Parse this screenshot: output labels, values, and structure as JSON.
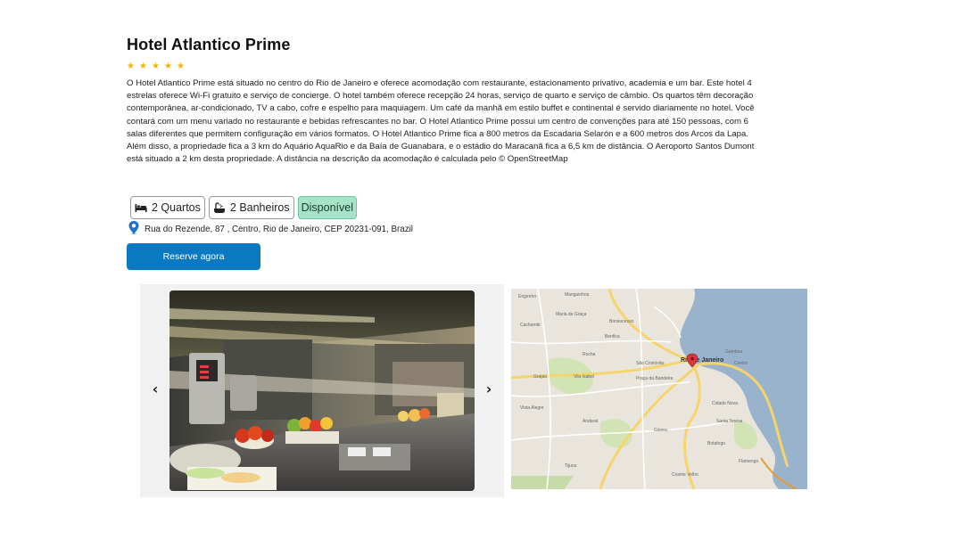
{
  "hotel": {
    "name": "Hotel Atlantico Prime",
    "stars": 5,
    "description": "O Hotel Atlantico Prime está situado no centro do Rio de Janeiro e oferece acomodação com restaurante, estacionamento privativo, academia e um bar. Este hotel 4 estrelas oferece Wi-Fi gratuito e serviço de concierge. O hotel também oferece recepção 24 horas, serviço de quarto e serviço de câmbio. Os quartos têm decoração contemporânea, ar-condicionado, TV a cabo, cofre e espelho para maquiagem. Um café da manhã em estilo buffet e continental é servido diariamente no hotel. Você contará com um menu variado no restaurante e bebidas refrescantes no bar. O Hotel Atlantico Prime possui um centro de convenções para até 150 pessoas, com 6 salas diferentes que permitem configuração em vários formatos. O Hotel Atlantico Prime fica a 800 metros da Escadaria Selarón e a 600 metros dos Arcos da Lapa. Além disso, a propriedade fica a 3 km do Aquário AquaRio e da Baía de Guanabara, e o estádio do Maracanã fica a 6,5 km de distância. O Aeroporto Santos Dumont está situado a 2 km desta propriedade. A distância na descrição da acomodação é calculada pelo © OpenStreetMap",
    "chips": {
      "rooms": "2 Quartos",
      "bathrooms": "2 Banheiros",
      "status": "Disponível"
    },
    "address": "Rua do Rezende, 87 , Centro, Rio de Janeiro, CEP 20231-091, Brazil",
    "book_label": "Reserve agora"
  },
  "icons": {
    "star": "star-icon",
    "bed": "bed-icon",
    "bath": "bath-icon",
    "pin": "map-pin-icon",
    "prev": "chevron-left-icon",
    "next": "chevron-right-icon"
  },
  "colors": {
    "star": "#f0b400",
    "button": "#0b78c2",
    "available_bg": "#a7e3c9",
    "map_pin": "#d9373a"
  },
  "map": {
    "city_label": "Rio de Janeiro"
  }
}
